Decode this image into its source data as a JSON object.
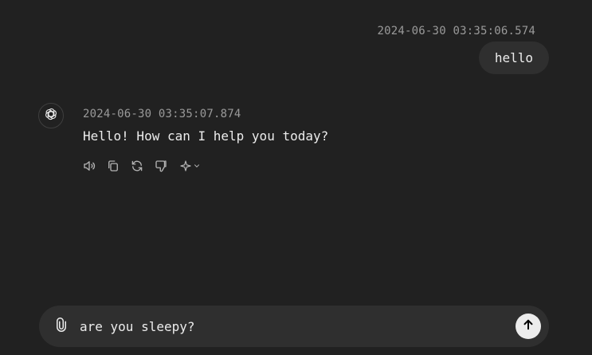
{
  "conversation": {
    "user_message": {
      "timestamp": "2024-06-30 03:35:06.574",
      "text": "hello"
    },
    "assistant_message": {
      "timestamp": "2024-06-30 03:35:07.874",
      "text": "Hello! How can I help you today?",
      "avatar_icon": "openai-logo-icon",
      "actions": [
        {
          "name": "read-aloud",
          "icon": "speaker-icon"
        },
        {
          "name": "copy",
          "icon": "copy-icon"
        },
        {
          "name": "regenerate",
          "icon": "refresh-icon"
        },
        {
          "name": "bad-response",
          "icon": "thumbs-down-icon"
        },
        {
          "name": "change-model",
          "icon": "sparkle-icon"
        }
      ]
    }
  },
  "composer": {
    "value": "are you sleepy?",
    "attach_icon": "paperclip-icon",
    "send_icon": "arrow-up-icon"
  },
  "colors": {
    "background": "#212121",
    "bubble": "#2f2f2f",
    "text": "#ececec",
    "muted": "#9a9a9a"
  }
}
